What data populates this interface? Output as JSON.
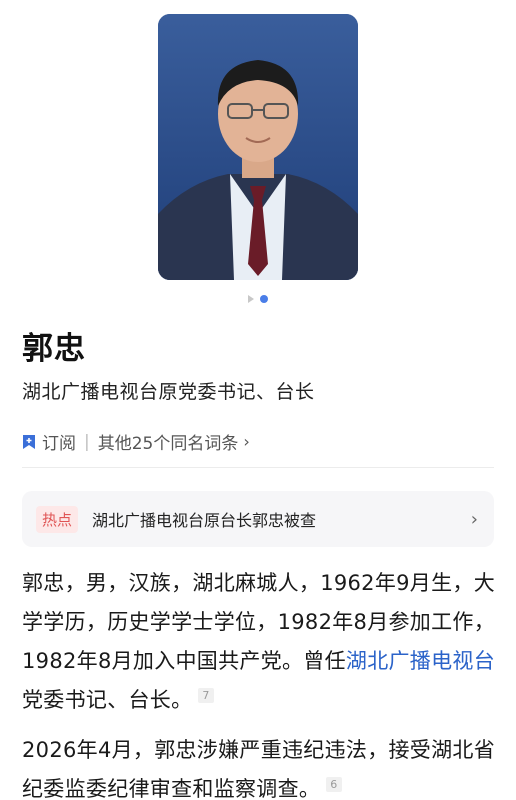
{
  "profile": {
    "name": "郭忠",
    "subtitle": "湖北广播电视台原党委书记、台长"
  },
  "subscribe": {
    "label": "订阅",
    "other_entries": "其他25个同名词条"
  },
  "hot": {
    "badge": "热点",
    "text": "湖北广播电视台原台长郭忠被查"
  },
  "bio": {
    "para1_text": "郭忠，男，汉族，湖北麻城人，1962年9月生，大学学历，历史学学士学位，1982年8月参加工作，1982年8月加入中国共产党。曾任",
    "para1_link": "湖北广播电视台",
    "para1_tail": "党委书记、台长。",
    "para1_ref": "7",
    "para2_text": "2026年4月，郭忠涉嫌严重违纪违法，接受湖北省纪委监委纪律审查和监察调查。",
    "para2_ref": "6"
  },
  "icons": {
    "bookmark": "bookmark-icon",
    "chevron": "chevron-right-icon"
  },
  "colors": {
    "accent": "#2b63c9",
    "hot": "#e05555",
    "carousel_active": "#4a7ee8"
  }
}
